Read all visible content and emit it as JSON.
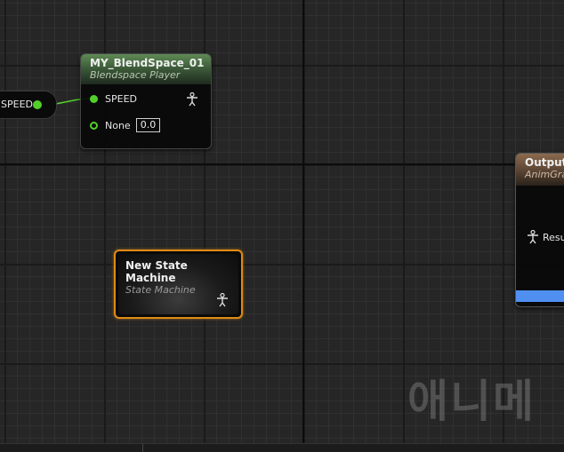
{
  "variable_node": {
    "label": "SPEED"
  },
  "blendspace_node": {
    "title": "MY_BlendSpace_01",
    "subtitle": "Blendspace Player",
    "pins": [
      {
        "label": "SPEED"
      },
      {
        "label": "None",
        "value": "0.0"
      }
    ]
  },
  "state_machine_node": {
    "title": "New State Machine",
    "subtitle": "State Machine"
  },
  "output_node": {
    "title": "Output P",
    "subtitle": "AnimGra",
    "pin_label": "Resu"
  },
  "watermark": {
    "text": "애니메"
  },
  "colors": {
    "float_pin": "#52d02a",
    "selection_outline": "#e08a14",
    "output_footer": "#4f8ff0"
  }
}
